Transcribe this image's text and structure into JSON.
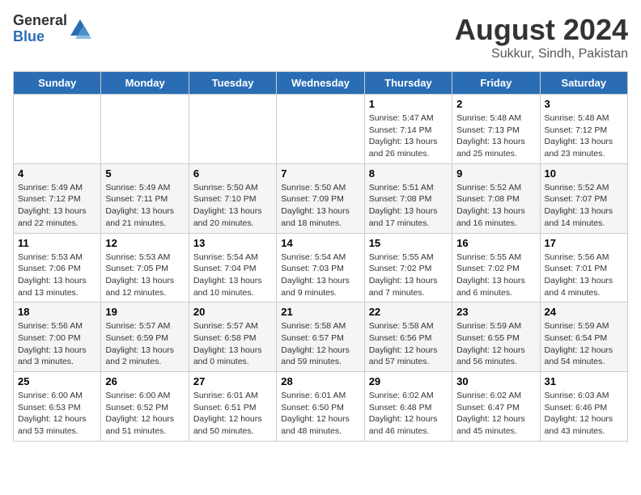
{
  "logo": {
    "general": "General",
    "blue": "Blue"
  },
  "header": {
    "month_year": "August 2024",
    "location": "Sukkur, Sindh, Pakistan"
  },
  "weekdays": [
    "Sunday",
    "Monday",
    "Tuesday",
    "Wednesday",
    "Thursday",
    "Friday",
    "Saturday"
  ],
  "weeks": [
    [
      {
        "day": "",
        "info": ""
      },
      {
        "day": "",
        "info": ""
      },
      {
        "day": "",
        "info": ""
      },
      {
        "day": "",
        "info": ""
      },
      {
        "day": "1",
        "info": "Sunrise: 5:47 AM\nSunset: 7:14 PM\nDaylight: 13 hours\nand 26 minutes."
      },
      {
        "day": "2",
        "info": "Sunrise: 5:48 AM\nSunset: 7:13 PM\nDaylight: 13 hours\nand 25 minutes."
      },
      {
        "day": "3",
        "info": "Sunrise: 5:48 AM\nSunset: 7:12 PM\nDaylight: 13 hours\nand 23 minutes."
      }
    ],
    [
      {
        "day": "4",
        "info": "Sunrise: 5:49 AM\nSunset: 7:12 PM\nDaylight: 13 hours\nand 22 minutes."
      },
      {
        "day": "5",
        "info": "Sunrise: 5:49 AM\nSunset: 7:11 PM\nDaylight: 13 hours\nand 21 minutes."
      },
      {
        "day": "6",
        "info": "Sunrise: 5:50 AM\nSunset: 7:10 PM\nDaylight: 13 hours\nand 20 minutes."
      },
      {
        "day": "7",
        "info": "Sunrise: 5:50 AM\nSunset: 7:09 PM\nDaylight: 13 hours\nand 18 minutes."
      },
      {
        "day": "8",
        "info": "Sunrise: 5:51 AM\nSunset: 7:08 PM\nDaylight: 13 hours\nand 17 minutes."
      },
      {
        "day": "9",
        "info": "Sunrise: 5:52 AM\nSunset: 7:08 PM\nDaylight: 13 hours\nand 16 minutes."
      },
      {
        "day": "10",
        "info": "Sunrise: 5:52 AM\nSunset: 7:07 PM\nDaylight: 13 hours\nand 14 minutes."
      }
    ],
    [
      {
        "day": "11",
        "info": "Sunrise: 5:53 AM\nSunset: 7:06 PM\nDaylight: 13 hours\nand 13 minutes."
      },
      {
        "day": "12",
        "info": "Sunrise: 5:53 AM\nSunset: 7:05 PM\nDaylight: 13 hours\nand 12 minutes."
      },
      {
        "day": "13",
        "info": "Sunrise: 5:54 AM\nSunset: 7:04 PM\nDaylight: 13 hours\nand 10 minutes."
      },
      {
        "day": "14",
        "info": "Sunrise: 5:54 AM\nSunset: 7:03 PM\nDaylight: 13 hours\nand 9 minutes."
      },
      {
        "day": "15",
        "info": "Sunrise: 5:55 AM\nSunset: 7:02 PM\nDaylight: 13 hours\nand 7 minutes."
      },
      {
        "day": "16",
        "info": "Sunrise: 5:55 AM\nSunset: 7:02 PM\nDaylight: 13 hours\nand 6 minutes."
      },
      {
        "day": "17",
        "info": "Sunrise: 5:56 AM\nSunset: 7:01 PM\nDaylight: 13 hours\nand 4 minutes."
      }
    ],
    [
      {
        "day": "18",
        "info": "Sunrise: 5:56 AM\nSunset: 7:00 PM\nDaylight: 13 hours\nand 3 minutes."
      },
      {
        "day": "19",
        "info": "Sunrise: 5:57 AM\nSunset: 6:59 PM\nDaylight: 13 hours\nand 2 minutes."
      },
      {
        "day": "20",
        "info": "Sunrise: 5:57 AM\nSunset: 6:58 PM\nDaylight: 13 hours\nand 0 minutes."
      },
      {
        "day": "21",
        "info": "Sunrise: 5:58 AM\nSunset: 6:57 PM\nDaylight: 12 hours\nand 59 minutes."
      },
      {
        "day": "22",
        "info": "Sunrise: 5:58 AM\nSunset: 6:56 PM\nDaylight: 12 hours\nand 57 minutes."
      },
      {
        "day": "23",
        "info": "Sunrise: 5:59 AM\nSunset: 6:55 PM\nDaylight: 12 hours\nand 56 minutes."
      },
      {
        "day": "24",
        "info": "Sunrise: 5:59 AM\nSunset: 6:54 PM\nDaylight: 12 hours\nand 54 minutes."
      }
    ],
    [
      {
        "day": "25",
        "info": "Sunrise: 6:00 AM\nSunset: 6:53 PM\nDaylight: 12 hours\nand 53 minutes."
      },
      {
        "day": "26",
        "info": "Sunrise: 6:00 AM\nSunset: 6:52 PM\nDaylight: 12 hours\nand 51 minutes."
      },
      {
        "day": "27",
        "info": "Sunrise: 6:01 AM\nSunset: 6:51 PM\nDaylight: 12 hours\nand 50 minutes."
      },
      {
        "day": "28",
        "info": "Sunrise: 6:01 AM\nSunset: 6:50 PM\nDaylight: 12 hours\nand 48 minutes."
      },
      {
        "day": "29",
        "info": "Sunrise: 6:02 AM\nSunset: 6:48 PM\nDaylight: 12 hours\nand 46 minutes."
      },
      {
        "day": "30",
        "info": "Sunrise: 6:02 AM\nSunset: 6:47 PM\nDaylight: 12 hours\nand 45 minutes."
      },
      {
        "day": "31",
        "info": "Sunrise: 6:03 AM\nSunset: 6:46 PM\nDaylight: 12 hours\nand 43 minutes."
      }
    ]
  ]
}
